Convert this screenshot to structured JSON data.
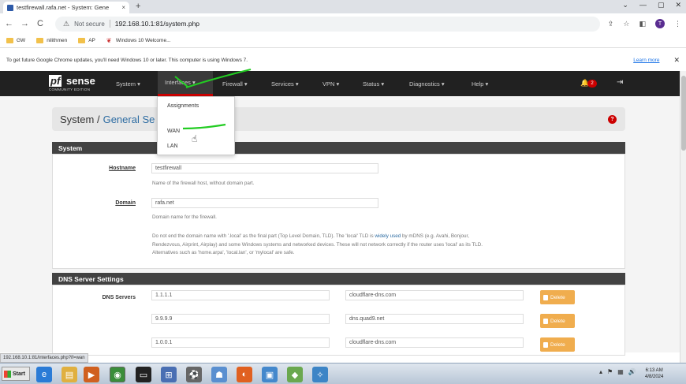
{
  "browser": {
    "tab_title": "testfirewall.rafa.net - System: Gene",
    "tab_close": "×",
    "new_tab": "+",
    "window_controls": [
      "⌄",
      "—",
      "▢",
      "✕"
    ],
    "back": "←",
    "forward": "→",
    "reload": "C",
    "not_secure": "Not secure",
    "url": "192.168.10.1:81/system.php",
    "bookmarks": [
      {
        "label": "GW",
        "icon": "folder-icon"
      },
      {
        "label": "nilithmen",
        "icon": "folder-icon"
      },
      {
        "label": "AP",
        "icon": "folder-icon"
      },
      {
        "label": "Windows 10 Welcome...",
        "icon": "pfsense-favicon"
      }
    ],
    "avatar_letter": "T",
    "infobar_message": "To get future Google Chrome updates, you'll need Windows 10 or later. This computer is using Windows 7.",
    "learn_more": "Learn more",
    "infobar_close": "✕",
    "status_url": "192.168.10.1:81/interfaces.php?if=wan"
  },
  "pfsense": {
    "logo_pf": "pf",
    "logo_sense": "sense",
    "logo_edition": "COMMUNITY EDITION",
    "menu": [
      {
        "label": "System ▾",
        "active": false
      },
      {
        "label": "Interfaces ▾",
        "active": true
      },
      {
        "label": "Firewall ▾",
        "active": false
      },
      {
        "label": "Services ▾",
        "active": false
      },
      {
        "label": "VPN ▾",
        "active": false
      },
      {
        "label": "Status ▾",
        "active": false
      },
      {
        "label": "Diagnostics ▾",
        "active": false
      },
      {
        "label": "Help ▾",
        "active": false
      }
    ],
    "notification_count": "2",
    "interfaces_dropdown": [
      "Assignments",
      "WAN",
      "LAN"
    ],
    "breadcrumb": {
      "section": "System /",
      "page": "General Se"
    },
    "help_icon": "?",
    "system_panel": {
      "title": "System",
      "hostname_label": "Hostname",
      "hostname_value": "testfirewall",
      "hostname_help": "Name of the firewall host, without domain part.",
      "domain_label": "Domain",
      "domain_value": "rafa.net",
      "domain_help": "Domain name for the firewall.",
      "domain_note_1": "Do not end the domain name with '.local' as the final part (Top Level Domain, TLD). The 'local' TLD is",
      "domain_note_link": "widely used",
      "domain_note_2": "by mDNS (e.g. Avahi, Bonjour,",
      "domain_note_3": "Rendezvous, Airprint, Airplay) and some Windows systems and networked devices. These will not network correctly if the router uses 'local' as its TLD.",
      "domain_note_4": "Alternatives such as 'home.arpa', 'local.lan', or 'mylocal' are safe."
    },
    "dns_panel": {
      "title": "DNS Server Settings",
      "servers_label": "DNS Servers",
      "servers": [
        {
          "ip": "1.1.1.1",
          "hostname": "cloudflare-dns.com",
          "action": "Delete"
        },
        {
          "ip": "9.9.9.9",
          "hostname": "dns.quad9.net",
          "action": "Delete"
        },
        {
          "ip": "1.0.0.1",
          "hostname": "cloudflare-dns.com",
          "action": "Delete"
        }
      ]
    }
  },
  "taskbar": {
    "start_label": "Start",
    "clock_time": "6:13 AM",
    "clock_date": "4/8/2024"
  },
  "colors": {
    "pfsense_nav": "#212121",
    "active_underline": "#cc0000",
    "delete_button": "#f0ad4e",
    "panel_header": "#424242",
    "link": "#2d6ca2",
    "annotation": "#22cc22"
  }
}
